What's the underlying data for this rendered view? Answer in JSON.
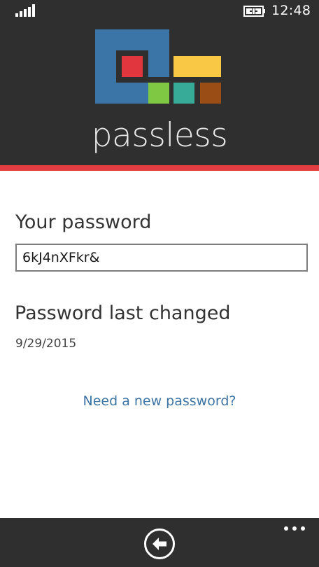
{
  "status_bar": {
    "time": "12:48",
    "signal_icon": "signal-bars-icon",
    "battery_icon": "battery-charging-icon"
  },
  "header": {
    "app_name": "passless",
    "logo_icon": "passless-logo-icon",
    "background_color": "#2f2f2f",
    "accent_color": "#e33d43"
  },
  "logo_colors": {
    "blue": "#3b75a8",
    "red": "#e2363f",
    "yellow": "#f9c945",
    "green": "#7ec843",
    "teal": "#37ab97",
    "brown": "#9a4e16"
  },
  "content": {
    "password_label": "Your password",
    "password_value": "6kJ4nXFkr&",
    "last_changed_label": "Password last changed",
    "last_changed_date": "9/29/2015",
    "new_password_link": "Need a new password?",
    "link_color": "#3d74a3"
  },
  "app_bar": {
    "back_icon": "back-arrow-icon",
    "more_icon": "more-dots-icon"
  }
}
